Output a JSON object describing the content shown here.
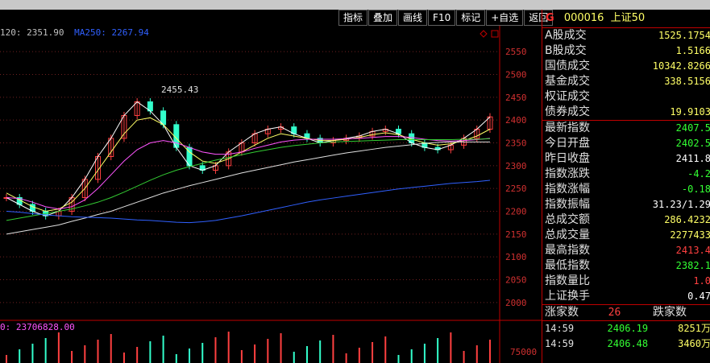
{
  "toolbar": {
    "buttons": [
      "指标",
      "叠加",
      "画线",
      "F10",
      "标记",
      "+自选",
      "返回"
    ]
  },
  "chart": {
    "ma_legend": [
      {
        "text": "120: 2351.90",
        "color": "#c0c0c0"
      },
      {
        "text": "MA250: 2267.94",
        "color": "#3060ff"
      }
    ],
    "peak_label": "2455.43",
    "vol_legend": "0: 23706828.00",
    "y_axis_labels": [
      "2550",
      "2500",
      "2450",
      "2400",
      "2350",
      "2300",
      "2250",
      "2200",
      "2150",
      "2100",
      "2050",
      "2000"
    ],
    "vol_axis_label": "75000"
  },
  "panel": {
    "code": "000016",
    "name": "上证50",
    "g_label": "G",
    "rows_top": [
      {
        "label": "A股成交",
        "value": "1525.1754",
        "color": "yellow"
      },
      {
        "label": "B股成交",
        "value": "1.5166",
        "color": "yellow"
      },
      {
        "label": "国债成交",
        "value": "10342.8266",
        "color": "yellow"
      },
      {
        "label": "基金成交",
        "value": "338.5156",
        "color": "yellow"
      },
      {
        "label": "权证成交",
        "value": "",
        "color": "yellow"
      },
      {
        "label": "债券成交",
        "value": "19.9103",
        "color": "yellow"
      }
    ],
    "rows_main": [
      {
        "label": "最新指数",
        "value": "2407.5",
        "color": "green"
      },
      {
        "label": "今日开盘",
        "value": "2402.5",
        "color": "green"
      },
      {
        "label": "昨日收盘",
        "value": "2411.8",
        "color": "white"
      },
      {
        "label": "指数涨跌",
        "value": "-4.2",
        "color": "green"
      },
      {
        "label": "指数涨幅",
        "value": "-0.18",
        "color": "green"
      },
      {
        "label": "指数振幅",
        "value": "31.23/1.29",
        "color": "white"
      },
      {
        "label": "总成交额",
        "value": "286.4232",
        "color": "yellow"
      },
      {
        "label": "总成交量",
        "value": "2277433",
        "color": "yellow"
      },
      {
        "label": "最高指数",
        "value": "2413.4",
        "color": "red"
      },
      {
        "label": "最低指数",
        "value": "2382.1",
        "color": "green"
      },
      {
        "label": "指数量比",
        "value": "1.0",
        "color": "red"
      },
      {
        "label": "上证换手",
        "value": "0.47",
        "color": "white"
      }
    ],
    "updown": {
      "up_label": "涨家数",
      "up_count": "26",
      "down_label": "跌家数"
    },
    "ticks": [
      {
        "time": "14:59",
        "price": "2406.19",
        "vol": "8251万"
      },
      {
        "time": "14:59",
        "price": "2406.48",
        "vol": "3460万"
      }
    ]
  },
  "chart_data": {
    "type": "line",
    "title": "",
    "ylim": [
      1975,
      2575
    ],
    "series": [
      {
        "name": "",
        "values": [
          2230,
          2215,
          2200,
          2190,
          2200,
          2230,
          2270,
          2320,
          2360,
          2410,
          2440,
          2420,
          2390,
          2340,
          2300,
          2290,
          2300,
          2330,
          2350,
          2370,
          2380,
          2385,
          2370,
          2360,
          2350,
          2355,
          2360,
          2365,
          2375,
          2380,
          2370,
          2350,
          2340,
          2335,
          2345,
          2360,
          2380,
          2407
        ],
        "color": "#ffffff"
      },
      {
        "name": "",
        "values": [
          2240,
          2225,
          2210,
          2200,
          2205,
          2220,
          2250,
          2290,
          2330,
          2370,
          2400,
          2405,
          2390,
          2360,
          2330,
          2310,
          2305,
          2315,
          2330,
          2345,
          2360,
          2370,
          2365,
          2360,
          2355,
          2355,
          2358,
          2362,
          2368,
          2372,
          2368,
          2358,
          2350,
          2345,
          2348,
          2355,
          2365,
          2380
        ],
        "color": "#ffff66"
      },
      {
        "name": "",
        "values": [
          2230,
          2228,
          2220,
          2210,
          2205,
          2210,
          2225,
          2250,
          2280,
          2310,
          2335,
          2350,
          2355,
          2350,
          2340,
          2330,
          2325,
          2325,
          2330,
          2338,
          2345,
          2352,
          2356,
          2358,
          2358,
          2358,
          2359,
          2360,
          2362,
          2364,
          2364,
          2362,
          2358,
          2355,
          2354,
          2355,
          2357,
          2360
        ],
        "color": "#ff55ff"
      },
      {
        "name": "",
        "values": [
          2180,
          2185,
          2190,
          2195,
          2200,
          2205,
          2212,
          2220,
          2230,
          2242,
          2255,
          2268,
          2280,
          2290,
          2298,
          2305,
          2312,
          2318,
          2324,
          2330,
          2335,
          2340,
          2344,
          2347,
          2350,
          2352,
          2353,
          2354,
          2355,
          2356,
          2357,
          2357,
          2357,
          2357,
          2357,
          2358,
          2358,
          2359
        ],
        "color": "#33cc33"
      },
      {
        "name": "",
        "values": [
          2150,
          2155,
          2160,
          2165,
          2170,
          2178,
          2185,
          2193,
          2200,
          2210,
          2220,
          2230,
          2240,
          2248,
          2256,
          2263,
          2270,
          2277,
          2284,
          2290,
          2296,
          2302,
          2308,
          2313,
          2318,
          2323,
          2328,
          2332,
          2336,
          2340,
          2343,
          2346,
          2349,
          2351,
          2352,
          2352,
          2352,
          2352
        ],
        "color": "#e0e0e0"
      },
      {
        "name": "",
        "values": [
          2200,
          2198,
          2195,
          2192,
          2190,
          2188,
          2187,
          2186,
          2185,
          2183,
          2181,
          2180,
          2178,
          2176,
          2175,
          2177,
          2180,
          2185,
          2190,
          2196,
          2202,
          2208,
          2214,
          2220,
          2225,
          2229,
          2233,
          2237,
          2241,
          2245,
          2249,
          2252,
          2255,
          2258,
          2261,
          2263,
          2265,
          2268
        ],
        "color": "#3060ff"
      }
    ]
  }
}
